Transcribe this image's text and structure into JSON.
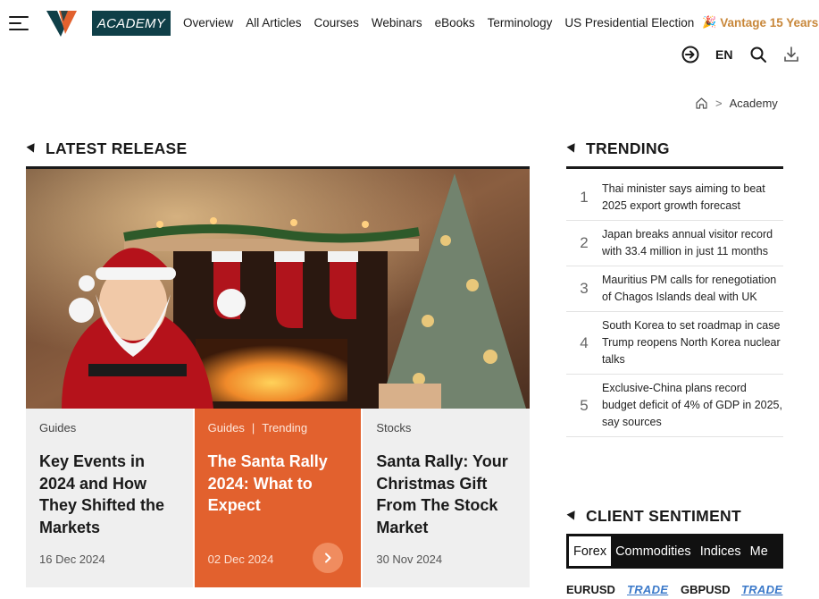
{
  "header": {
    "badge": "ACADEMY",
    "nav": [
      "Overview",
      "All Articles",
      "Courses",
      "Webinars",
      "eBooks",
      "Terminology",
      "US Presidential Election"
    ],
    "promo": "Vantage 15 Years",
    "language": "EN"
  },
  "breadcrumb": {
    "current": "Academy"
  },
  "latest": {
    "heading": "LATEST RELEASE",
    "cards": [
      {
        "cats": [
          "Guides"
        ],
        "title": "Key Events in 2024 and How They Shifted the Markets",
        "date": "16 Dec 2024"
      },
      {
        "cats": [
          "Guides",
          "|",
          "Trending"
        ],
        "title": "The Santa Rally 2024: What to Expect",
        "date": "02 Dec 2024"
      },
      {
        "cats": [
          "Stocks"
        ],
        "title": "Santa Rally: Your Christmas Gift From The Stock Market",
        "date": "30 Nov 2024"
      }
    ]
  },
  "trending": {
    "heading": "TRENDING",
    "items": [
      {
        "n": "1",
        "text": "Thai minister says aiming to beat 2025 export growth forecast"
      },
      {
        "n": "2",
        "text": "Japan breaks annual visitor record with 33.4 million in just 11 months"
      },
      {
        "n": "3",
        "text": "Mauritius PM calls for renegotiation of Chagos Islands deal with UK"
      },
      {
        "n": "4",
        "text": "South Korea to set roadmap in case Trump reopens North Korea nuclear talks"
      },
      {
        "n": "5",
        "text": "Exclusive-China plans record budget deficit of 4% of GDP in 2025, say sources"
      }
    ]
  },
  "sentiment": {
    "heading": "CLIENT SENTIMENT",
    "tabs": [
      "Forex",
      "Commodities",
      "Indices",
      "Me"
    ],
    "pairs": [
      {
        "symbol": "EURUSD",
        "action": "TRADE"
      },
      {
        "symbol": "GBPUSD",
        "action": "TRADE"
      }
    ]
  },
  "colors": {
    "accent": "#e2612e",
    "brand_dark": "#0f3f48",
    "promo": "#c8873a",
    "trade_link": "#3b79c9"
  }
}
